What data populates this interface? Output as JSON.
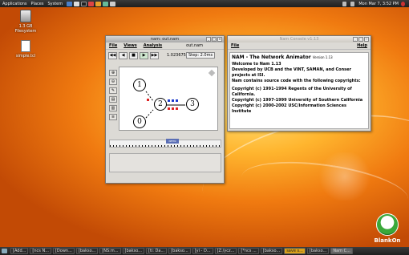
{
  "top_panel": {
    "menus": [
      "Applications",
      "Places",
      "System"
    ],
    "clock": "Mon Mar 7, 3:52 PM"
  },
  "desktop": {
    "icons": [
      "1.3 GB Filesystem",
      "simple.tcl"
    ]
  },
  "nam_window": {
    "title": "nam: out.nam",
    "menus": [
      "File",
      "Views",
      "Analysis"
    ],
    "file_label": "out.nam",
    "time": "1.023675",
    "step": "Step: 2.0ms",
    "slider_label": "NETIN",
    "nodes": [
      "1",
      "2",
      "3",
      "0"
    ]
  },
  "console_window": {
    "title": "Nam Console v1.13",
    "menus": [
      "File",
      "Help"
    ],
    "heading": "NAM - The Network Animator",
    "version": "Version 1.13",
    "lines": [
      "Welcome to Nam 1.13",
      "Developed by UCB and the VINT, SAMAN, and Conser projects at ISI.",
      "Nam contains source code with the following copyrights:",
      "Copyright (c) 1991-1994 Regents of the University of California.",
      "Copyright (c) 1997-1999 University of Southern California",
      "Copyright (c) 2000-2002 USC/Information Sciences Institute"
    ]
  },
  "taskbar": {
    "items": [
      "[Add...",
      "[ncs N...",
      "[Down...",
      "[bakso...",
      "[NS:m...",
      "[bakso...",
      "[ti: Da...",
      "[bakso...",
      "[yi - D...",
      "[Z:/ycz...",
      "[*ncs ...",
      "[bakso...",
      "save s...",
      "[bakso...",
      "Nam C..."
    ]
  },
  "brand": {
    "name": "BlankOn"
  }
}
